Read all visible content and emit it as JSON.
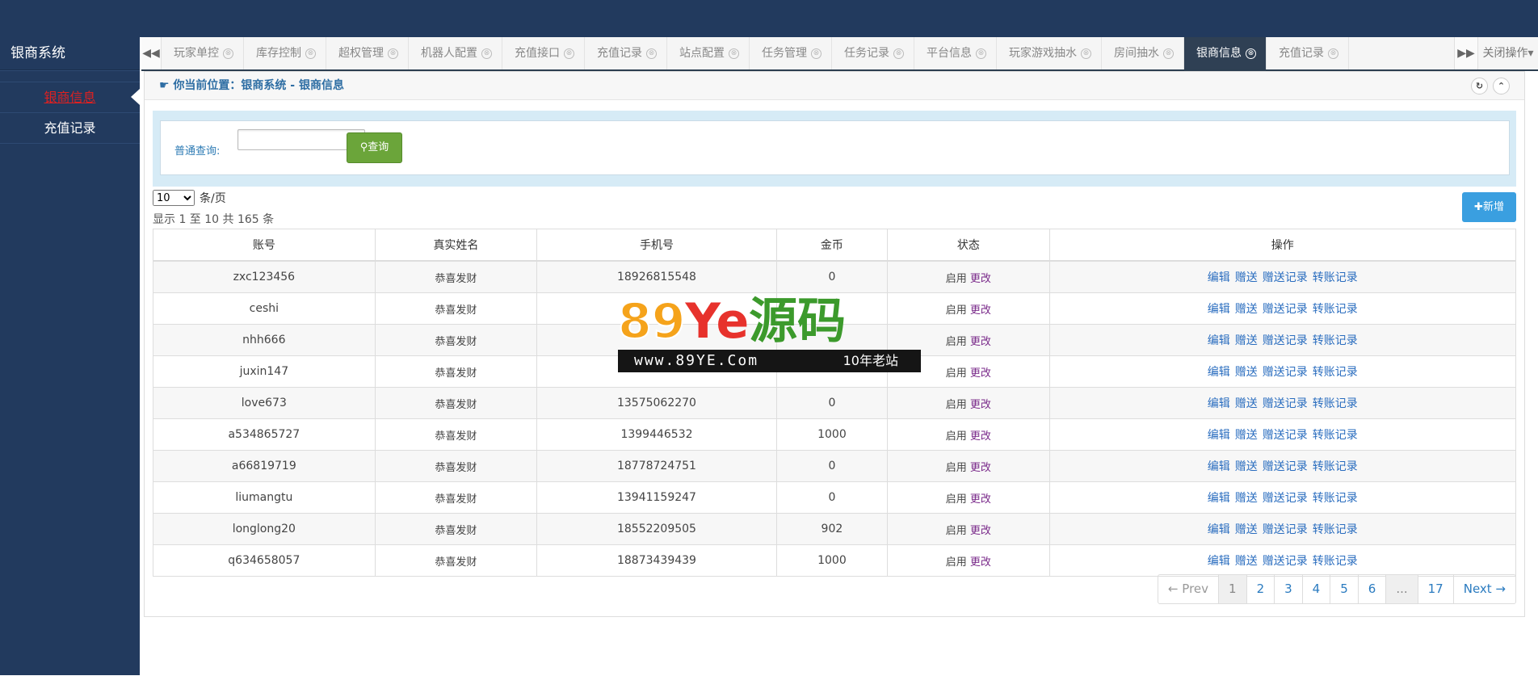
{
  "sidebar": {
    "title": "银商系统",
    "items": [
      {
        "label": "银商信息"
      },
      {
        "label": "充值记录"
      }
    ]
  },
  "tabs": {
    "items": [
      {
        "label": "玩家单控"
      },
      {
        "label": "库存控制"
      },
      {
        "label": "超权管理"
      },
      {
        "label": "机器人配置"
      },
      {
        "label": "充值接口"
      },
      {
        "label": "充值记录"
      },
      {
        "label": "站点配置"
      },
      {
        "label": "任务管理"
      },
      {
        "label": "任务记录"
      },
      {
        "label": "平台信息"
      },
      {
        "label": "玩家游戏抽水"
      },
      {
        "label": "房间抽水"
      },
      {
        "label": "银商信息"
      },
      {
        "label": "充值记录"
      }
    ],
    "close_ops": "关闭操作",
    "close_glyph": "⊗"
  },
  "breadcrumb": "你当前位置：银商系统 - 银商信息",
  "search": {
    "label": "普通查询:",
    "placeholder": "",
    "button": "查询"
  },
  "page_size": {
    "value": "10",
    "suffix": "条/页"
  },
  "showing": "显示 1 至 10 共 165 条",
  "add_button": "新增",
  "table": {
    "headers": [
      "账号",
      "真实姓名",
      "手机号",
      "金币",
      "状态",
      "操作"
    ],
    "rows": [
      {
        "account": "zxc123456",
        "name": "恭喜发财",
        "phone": "18926815548",
        "gold": "0",
        "status": "启用",
        "change": "更改"
      },
      {
        "account": "ceshi",
        "name": "恭喜发财",
        "phone": "",
        "gold": "",
        "status": "启用",
        "change": "更改"
      },
      {
        "account": "nhh666",
        "name": "恭喜发财",
        "phone": "",
        "gold": "",
        "status": "启用",
        "change": "更改"
      },
      {
        "account": "juxin147",
        "name": "恭喜发财",
        "phone": "",
        "gold": "",
        "status": "启用",
        "change": "更改"
      },
      {
        "account": "love673",
        "name": "恭喜发财",
        "phone": "13575062270",
        "gold": "0",
        "status": "启用",
        "change": "更改"
      },
      {
        "account": "a534865727",
        "name": "恭喜发财",
        "phone": "1399446532",
        "gold": "1000",
        "status": "启用",
        "change": "更改"
      },
      {
        "account": "a66819719",
        "name": "恭喜发财",
        "phone": "18778724751",
        "gold": "0",
        "status": "启用",
        "change": "更改"
      },
      {
        "account": "liumangtu",
        "name": "恭喜发财",
        "phone": "13941159247",
        "gold": "0",
        "status": "启用",
        "change": "更改"
      },
      {
        "account": "longlong20",
        "name": "恭喜发财",
        "phone": "18552209505",
        "gold": "902",
        "status": "启用",
        "change": "更改"
      },
      {
        "account": "q634658057",
        "name": "恭喜发财",
        "phone": "18873439439",
        "gold": "1000",
        "status": "启用",
        "change": "更改"
      }
    ],
    "actions": [
      "编辑",
      "赠送",
      "赠送记录",
      "转账记录"
    ]
  },
  "pagination": [
    "← Prev",
    "1",
    "2",
    "3",
    "4",
    "5",
    "6",
    "...",
    "17",
    "Next →"
  ],
  "watermark": {
    "big": "89Ye源码",
    "url": "www.89YE.Com",
    "tag": "10年老站"
  }
}
